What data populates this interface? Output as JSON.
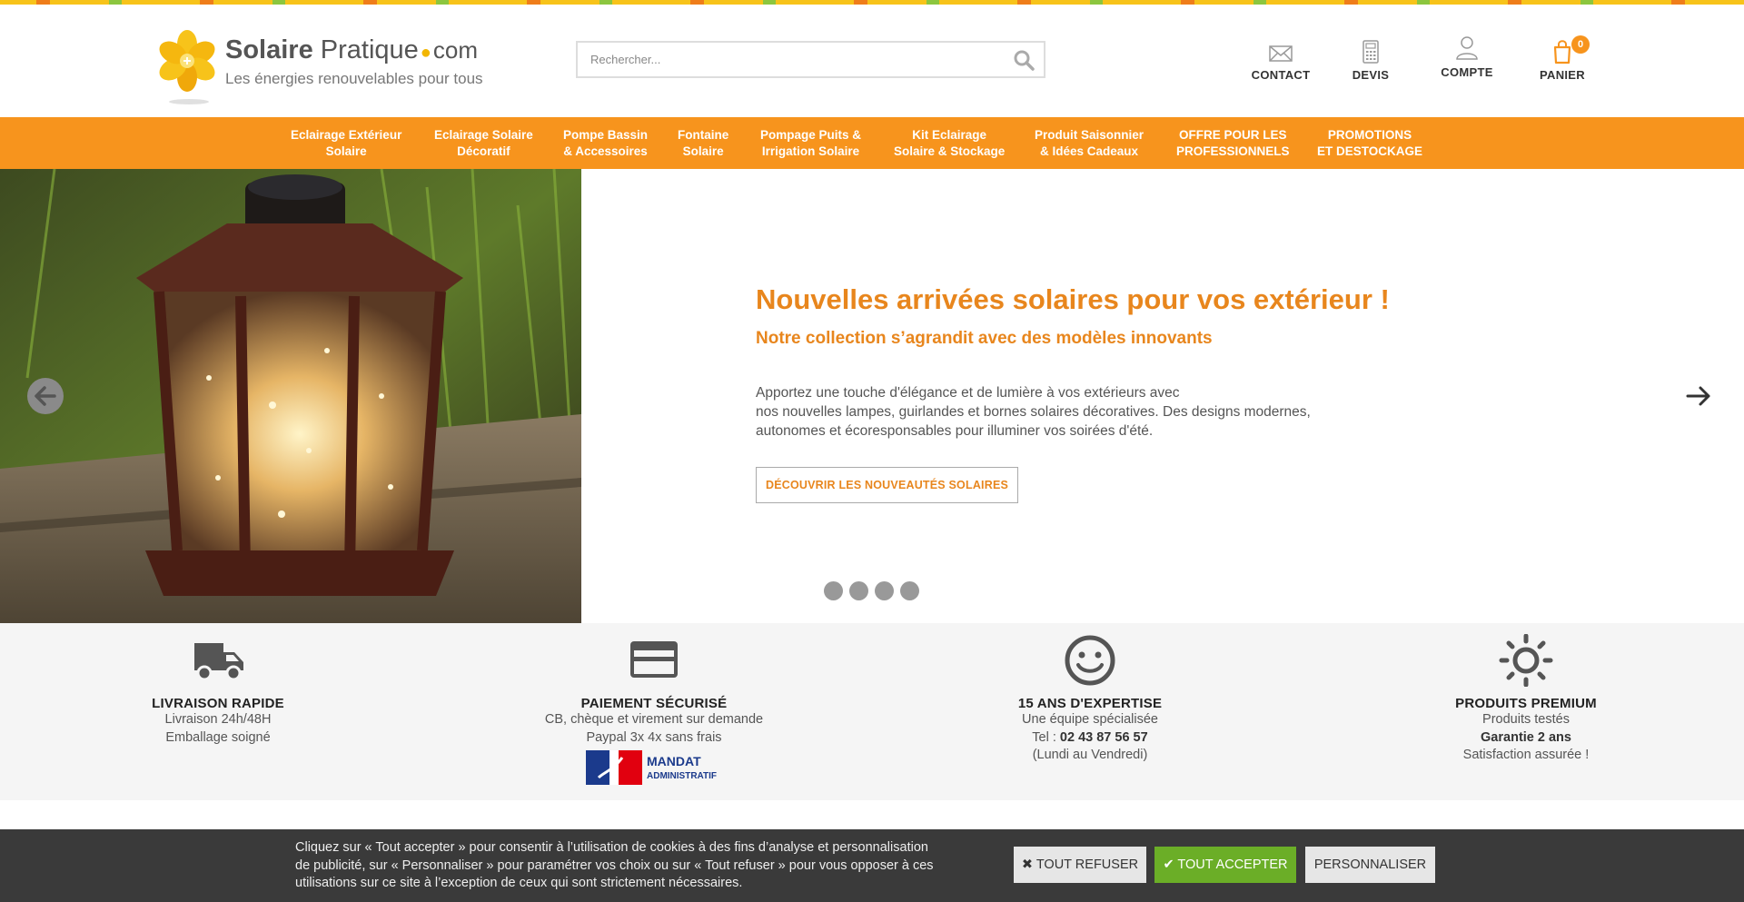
{
  "header": {
    "logo": {
      "name_bold": "Solaire",
      "name_regular": "Pratique",
      "name_suffix": "com",
      "tagline": "Les énergies renouvelables pour tous"
    },
    "search": {
      "placeholder": "Rechercher..."
    },
    "links": [
      {
        "label": "CONTACT",
        "icon": "envelope-icon"
      },
      {
        "label": "DEVIS",
        "icon": "calculator-icon"
      },
      {
        "label": "COMPTE",
        "icon": "user-icon"
      },
      {
        "label": "PANIER",
        "icon": "shopping-bag-icon",
        "badge": "0"
      }
    ]
  },
  "nav": {
    "items": [
      {
        "line1": "Eclairage Extérieur",
        "line2": "Solaire"
      },
      {
        "line1": "Eclairage Solaire",
        "line2": "Décoratif"
      },
      {
        "line1": "Pompe Bassin",
        "line2": "& Accessoires"
      },
      {
        "line1": "Fontaine",
        "line2": "Solaire"
      },
      {
        "line1": "Pompage Puits &",
        "line2": "Irrigation Solaire"
      },
      {
        "line1": "Kit Eclairage",
        "line2": "Solaire & Stockage"
      },
      {
        "line1": "Produit Saisonnier",
        "line2": "& Idées Cadeaux"
      },
      {
        "line1": "OFFRE POUR LES",
        "line2": "PROFESSIONNELS"
      },
      {
        "line1": "PROMOTIONS",
        "line2": "ET DESTOCKAGE"
      }
    ]
  },
  "hero": {
    "title": "Nouvelles arrivées solaires pour vos extérieur !",
    "subtitle": "Notre collection s’agrandit avec des modèles innovants",
    "text_line1": "Apportez une touche d'élégance et de lumière à vos extérieurs avec",
    "text_line2": "nos nouvelles lampes, guirlandes et bornes solaires décoratives. Des designs modernes,",
    "text_line3": "autonomes et écoresponsables pour illuminer vos soirées d'été.",
    "cta": "DÉCOUVRIR LES NOUVEAUTÉS SOLAIRES",
    "slide_count": 4,
    "accent_color": "#e8861d"
  },
  "features": [
    {
      "icon": "truck-icon",
      "title": "LIVRAISON RAPIDE",
      "line1": "Livraison 24h/48H",
      "line2": "Emballage soigné"
    },
    {
      "icon": "credit-card-icon",
      "title": "PAIEMENT SÉCURISÉ",
      "line1": "CB, chèque et virement sur demande",
      "line2": "Paypal 3x 4x sans frais",
      "badge_line1": "MANDAT",
      "badge_line2": "ADMINISTRATIF"
    },
    {
      "icon": "smiley-icon",
      "title": "15 ANS D'EXPERTISE",
      "line1": "Une équipe spécialisée",
      "line2_prefix": "Tel : ",
      "line2_phone": "02 43 87 56 57",
      "line3": "(Lundi au Vendredi)"
    },
    {
      "icon": "sun-icon",
      "title": "PRODUITS PREMIUM",
      "line1": "Produits testés",
      "line2": "Garantie 2 ans",
      "line3": "Satisfaction assurée !"
    }
  ],
  "cookie": {
    "line1": "Cliquez sur « Tout accepter » pour consentir à l’utilisation de cookies à des fins d’analyse et personnalisation",
    "line2": "de publicité, sur « Personnaliser » pour paramétrer vos choix ou sur « Tout refuser » pour vous opposer à ces",
    "line3": "utilisations sur ce site à l’exception de ceux qui sont strictement nécessaires.",
    "refuse": "TOUT REFUSER",
    "accept": "TOUT ACCEPTER",
    "customize": "PERSONNALISER"
  },
  "colors": {
    "brand_orange": "#f7941d",
    "accept_green": "#6bae27",
    "cookie_bg": "#3a3a3a"
  }
}
